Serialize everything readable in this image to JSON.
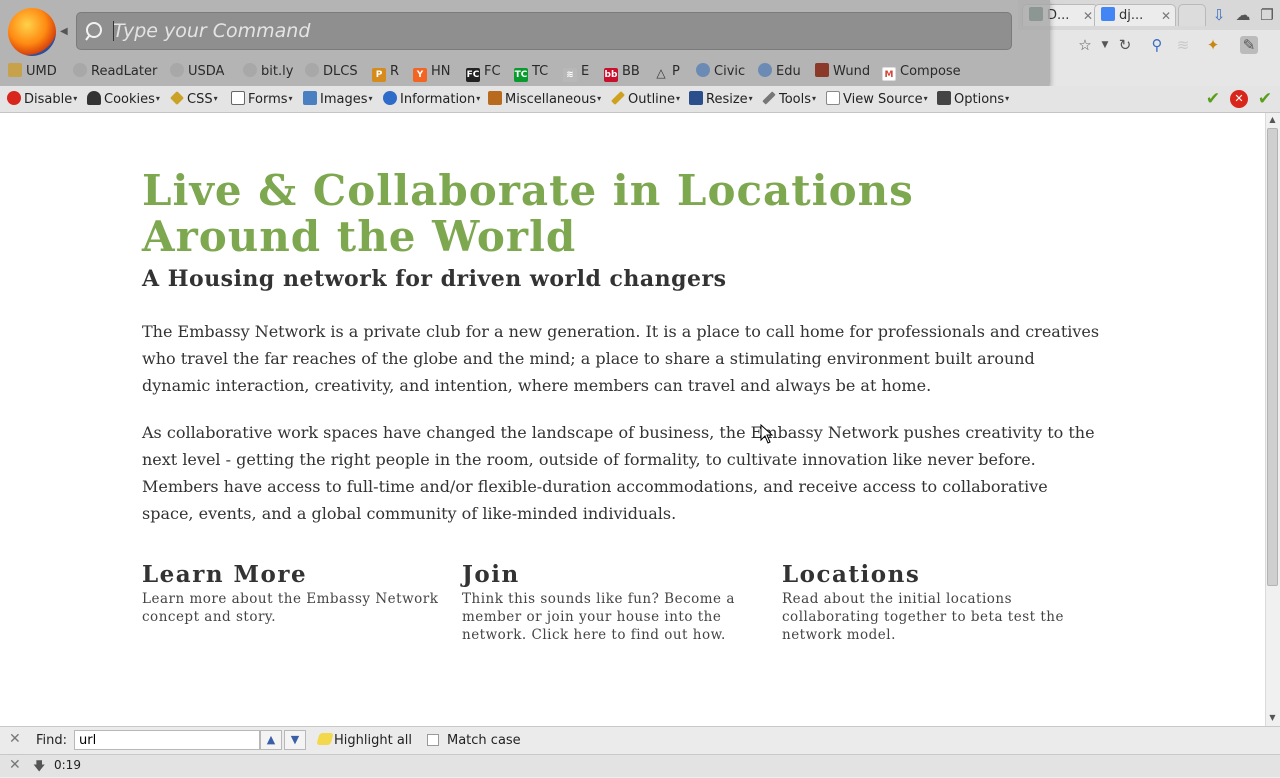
{
  "browser": {
    "tabs": [
      {
        "label": "D...",
        "icon_color": "#0c4b33"
      },
      {
        "label": "dj...",
        "icon_color": "#4285f4"
      }
    ],
    "command_placeholder": "Type your Command"
  },
  "bookmarks": [
    {
      "label": "UMD",
      "icon": "folder-icon",
      "color": "#c8a24a"
    },
    {
      "label": "ReadLater",
      "icon": "globe-icon",
      "color": "#9a9a9a"
    },
    {
      "label": "USDA",
      "icon": "globe-icon",
      "color": "#9a9a9a"
    },
    {
      "label": "bit.ly",
      "icon": "globe-icon",
      "color": "#9a9a9a"
    },
    {
      "label": "DLCS",
      "icon": "globe-icon",
      "color": "#9a9a9a"
    },
    {
      "label": "R",
      "icon": "pinboard-icon",
      "color": "#d68b1d"
    },
    {
      "label": "HN",
      "icon": "hackernews-icon",
      "color": "#f26522"
    },
    {
      "label": "FC",
      "icon": "fc-icon",
      "color": "#222222"
    },
    {
      "label": "TC",
      "icon": "techcrunch-icon",
      "color": "#0a9a2e"
    },
    {
      "label": "E",
      "icon": "rss-icon",
      "color": "#9a9a9a"
    },
    {
      "label": "BB",
      "icon": "bb-icon",
      "color": "#c8102e"
    },
    {
      "label": "P",
      "icon": "triangle-icon",
      "color": "#333333"
    },
    {
      "label": "Civic",
      "icon": "reddit-icon",
      "color": "#6b8bb5"
    },
    {
      "label": "Edu",
      "icon": "reddit-icon",
      "color": "#6b8bb5"
    },
    {
      "label": "Wund",
      "icon": "book-icon",
      "color": "#8b3a2a"
    },
    {
      "label": "Compose",
      "icon": "gmail-icon",
      "color": "#d44638"
    }
  ],
  "devbar": {
    "items": [
      {
        "label": "Disable",
        "icon": "disable-icon",
        "color": "#d8261c"
      },
      {
        "label": "Cookies",
        "icon": "cookies-icon",
        "color": "#333333"
      },
      {
        "label": "CSS",
        "icon": "css-icon",
        "color": "#c9a227"
      },
      {
        "label": "Forms",
        "icon": "forms-icon",
        "color": "#666666"
      },
      {
        "label": "Images",
        "icon": "images-icon",
        "color": "#4a7fc1"
      },
      {
        "label": "Information",
        "icon": "information-icon",
        "color": "#2d6cc8"
      },
      {
        "label": "Miscellaneous",
        "icon": "miscellaneous-icon",
        "color": "#b86b1f"
      },
      {
        "label": "Outline",
        "icon": "outline-icon",
        "color": "#d0a020"
      },
      {
        "label": "Resize",
        "icon": "resize-icon",
        "color": "#2a4f8a"
      },
      {
        "label": "Tools",
        "icon": "tools-icon",
        "color": "#555555"
      },
      {
        "label": "View Source",
        "icon": "view-source-icon",
        "color": "#888888"
      },
      {
        "label": "Options",
        "icon": "options-icon",
        "color": "#444444"
      }
    ]
  },
  "page": {
    "headline": "Live & Collaborate in Locations Around the World",
    "subheadline": "A Housing network for driven world changers",
    "paragraphs": [
      "The Embassy Network is a private club for a new generation. It is a place to call home for professionals and creatives who travel the far reaches of the globe and the mind; a place to share a stimulating environment built around dynamic interaction, creativity, and intention, where members can travel and always be at home.",
      "As collaborative work spaces have changed the landscape of business, the Embassy Network pushes creativity to the next level - getting the right people in the room, outside of formality, to cultivate innovation like never before. Members have access to full-time and/or flexible-duration accommodations, and receive access to collaborative space, events, and a global community of like-minded individuals."
    ],
    "columns": [
      {
        "title": "Learn More",
        "text": "Learn more about the Embassy Network concept and story."
      },
      {
        "title": "Join",
        "text": "Think this sounds like fun? Become a member or join your house into the network. Click here to find out how."
      },
      {
        "title": "Locations",
        "text": "Read about the initial locations collaborating together to beta test the network model."
      }
    ]
  },
  "findbar": {
    "label": "Find:",
    "query": "url",
    "highlight_label": "Highlight all",
    "match_case_label": "Match case",
    "match_case_checked": false
  },
  "statusbar": {
    "time": "0:19"
  },
  "colors": {
    "headline": "#7ea84f",
    "accept": "#5a9e1c",
    "reject": "#d8261c"
  }
}
